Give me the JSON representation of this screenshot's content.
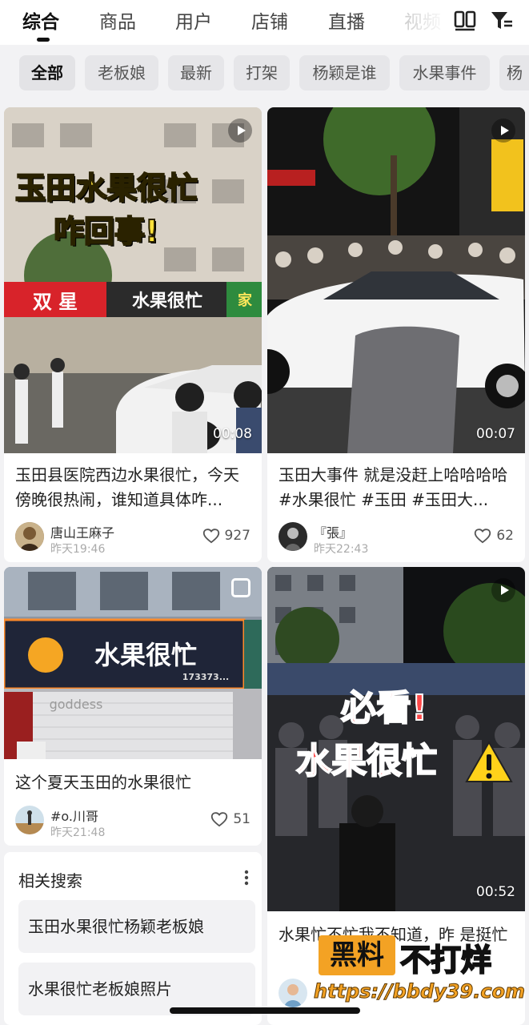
{
  "tabs": [
    {
      "label": "综合",
      "active": true
    },
    {
      "label": "商品"
    },
    {
      "label": "用户"
    },
    {
      "label": "店铺"
    },
    {
      "label": "直播"
    },
    {
      "label": "视频"
    }
  ],
  "top_icons": [
    "double-column-layout-icon",
    "filter-icon"
  ],
  "chips": [
    {
      "label": "全部",
      "active": true
    },
    {
      "label": "老板娘"
    },
    {
      "label": "最新"
    },
    {
      "label": "打架"
    },
    {
      "label": "杨颖是谁"
    },
    {
      "label": "水果事件"
    },
    {
      "label": "杨"
    }
  ],
  "cards": [
    {
      "type": "video",
      "overlay_line1": "玉田水果很忙",
      "overlay_line2": "咋回事!",
      "signs": [
        "双 星",
        "水果很忙",
        "家"
      ],
      "duration": "00:08",
      "title": "玉田县医院西边水果很忙，今天傍晚很热闹，谁知道具体咋...",
      "author": "唐山王麻子",
      "time": "昨天19:46",
      "likes": "927"
    },
    {
      "type": "video",
      "duration": "00:07",
      "title": "玉田大事件 就是没赶上哈哈哈哈#水果很忙 #玉田 #玉田大...",
      "author": "『張』",
      "time": "昨天22:43",
      "likes": "62"
    },
    {
      "type": "album",
      "sign": "水果很忙",
      "sign_sub": "173373...",
      "shutter_text": "goddess",
      "title": "这个夏天玉田的水果很忙",
      "author": "#o.川哥",
      "time": "昨天21:48",
      "likes": "51"
    },
    {
      "type": "video",
      "overlay_line1": "必看!",
      "overlay_line2": "水果很忙",
      "duration": "00:52",
      "title": "水果忙不忙我不知道，昨 是挺忙"
    }
  ],
  "related": {
    "title": "相关搜索",
    "items": [
      "玉田水果很忙杨颖老板娘",
      "水果很忙老板娘照片"
    ]
  },
  "watermark": {
    "box": "黑料",
    "text": "不打烊",
    "url": "https://bbdy39.com"
  },
  "colors": {
    "accent_dark": "#111111",
    "overlay_yellow": "#ffe13a",
    "overlay_red": "#ff4a4a",
    "watermark_orange": "#f3a224",
    "background": "#f2f2f4"
  }
}
